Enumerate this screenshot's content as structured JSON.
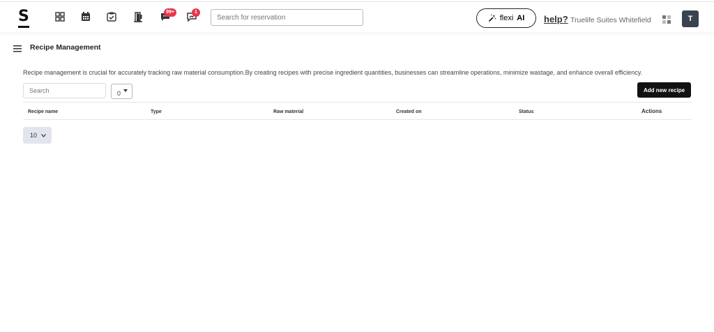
{
  "header": {
    "logo_text": "S",
    "search_placeholder": "Search for reservation",
    "flexi_label_prefix": "flexi",
    "flexi_label_strong": "AI",
    "help_label": "help?",
    "property_name": "Truelife Suites Whitefield",
    "avatar_initial": "T",
    "messages_badge": "99+",
    "notifications_badge": "1",
    "icons": [
      "dashboard-icon",
      "calendar-icon",
      "checklist-icon",
      "door-icon",
      "messages-icon",
      "reviews-icon",
      "magic-wand-icon",
      "apps-icon"
    ]
  },
  "page": {
    "title": "Recipe Management",
    "description": "Recipe management is crucial for accurately tracking raw material consumption.By creating recipes with precise ingredient quantities, businesses can streamline operations, minimize wastage, and enhance overall efficiency.",
    "search_placeholder": "Search",
    "filter_value": "0",
    "add_button": "Add new recipe"
  },
  "table": {
    "columns": [
      "Recipe name",
      "Type",
      "Raw material",
      "Created on",
      "Status",
      "Actions"
    ],
    "rows": []
  },
  "pagination": {
    "per_page": "10"
  },
  "colors": {
    "badge": "#e8364a",
    "avatar": "#3a4450",
    "primary_button": "#111111",
    "perpage_bg": "#e2e5ee"
  }
}
